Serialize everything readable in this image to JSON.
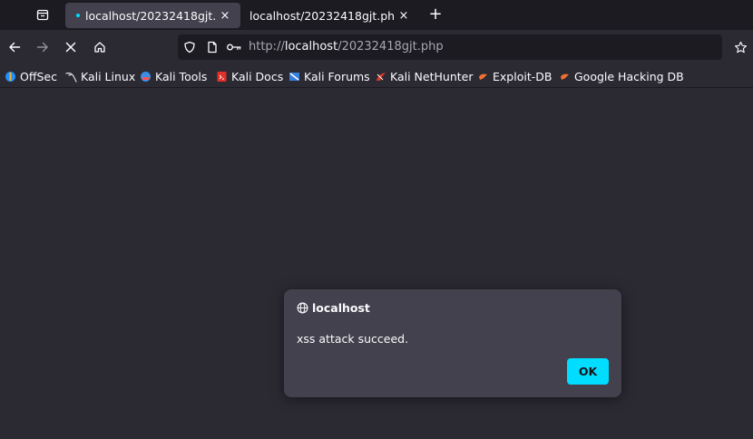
{
  "tabs": [
    {
      "title": "localhost/20232418gjt.php",
      "active": true
    },
    {
      "title": "localhost/20232418gjt.php",
      "active": false
    }
  ],
  "tab_close_glyph": "×",
  "new_tab_glyph": "+",
  "url": {
    "scheme": "http://",
    "host": "localhost",
    "path": "/20232418gjt.php"
  },
  "bookmarks": [
    {
      "label": "OffSec",
      "icon": "offsec-icon",
      "color": "#1e90ff"
    },
    {
      "label": "Kali Linux",
      "icon": "kali-dragon-icon",
      "color": "#cfd2d6"
    },
    {
      "label": "Kali Tools",
      "icon": "kali-tools-icon",
      "color": "#3a8ee6"
    },
    {
      "label": "Kali Docs",
      "icon": "kali-docs-icon",
      "color": "#e0302a"
    },
    {
      "label": "Kali Forums",
      "icon": "kali-forums-icon",
      "color": "#3a7fd9"
    },
    {
      "label": "Kali NetHunter",
      "icon": "nethunter-icon",
      "color": "#e03a2a"
    },
    {
      "label": "Exploit-DB",
      "icon": "exploit-db-icon",
      "color": "#f07030"
    },
    {
      "label": "Google Hacking DB",
      "icon": "ghdb-icon",
      "color": "#f07030"
    }
  ],
  "dialog": {
    "origin": "localhost",
    "message": "xss attack succeed.",
    "ok_label": "OK"
  },
  "colors": {
    "accent": "#00ddff",
    "toolbar": "#2b2a33",
    "tabstrip": "#1c1b22",
    "dialog": "#42414d"
  }
}
